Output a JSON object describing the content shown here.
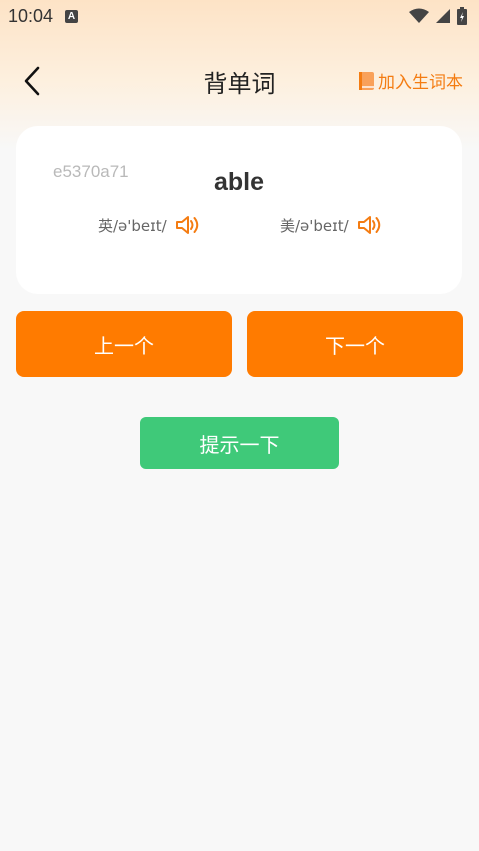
{
  "status_bar": {
    "time": "10:04",
    "notification_badge": "A"
  },
  "nav": {
    "title": "背单词",
    "add_vocab_label": "加入生词本"
  },
  "card": {
    "word_id": "e5370a71",
    "word": "able",
    "uk_phonetic": "英/ə'beɪt/",
    "us_phonetic": "美/ə'beɪt/"
  },
  "buttons": {
    "prev": "上一个",
    "next": "下一个",
    "hint": "提示一下"
  },
  "colors": {
    "accent_orange": "#ff7b00",
    "hint_green": "#3fc979",
    "link_orange": "#f47c12"
  },
  "icons": [
    "back-arrow-icon",
    "book-icon",
    "speaker-icon",
    "wifi-icon",
    "signal-icon",
    "battery-icon"
  ]
}
